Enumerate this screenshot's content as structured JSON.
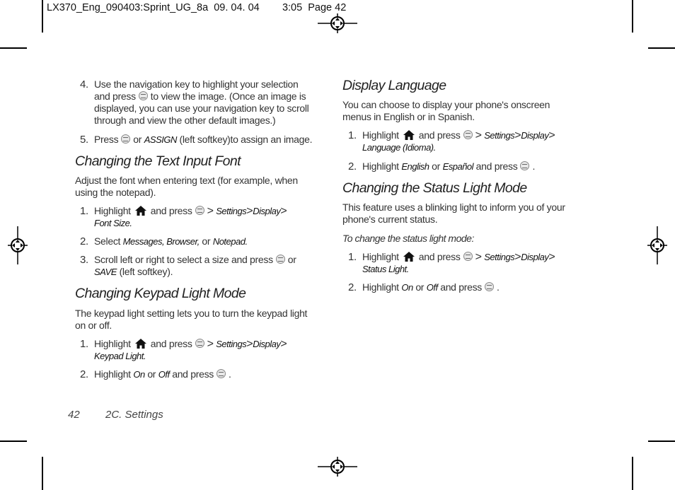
{
  "slug": {
    "file": "LX370_Eng_090403:Sprint_UG_8a",
    "date": "09. 04. 04",
    "time_page": "3:05  Page 42"
  },
  "left_column": {
    "intro_steps": [
      {
        "num": "4.",
        "line1": "Use the navigation key to highlight your selection",
        "line2a": "and press",
        "line2b": "to view the image. (Once an image is",
        "line3": "displayed, you can use your navigation key to scroll",
        "line4": "through and view the other default images.)"
      },
      {
        "num": "5.",
        "pre": "Press",
        "mid": "or",
        "em": "ASSIGN",
        "post": "(left softkey)to assign an image."
      }
    ],
    "text_input_font": {
      "heading": "Changing the Text Input Font",
      "para_line1": "Adjust the font when entering text (for example, when",
      "para_line2": "using the notepad).",
      "steps": [
        {
          "num": "1.",
          "pre": "Highlight",
          "mid": "and press",
          "path1": "Settings",
          "path2": "Display",
          "path3": "Font Size."
        },
        {
          "num": "2.",
          "pre": "Select",
          "em1": "Messages, Browser,",
          "mid": "or",
          "em2": "Notepad."
        },
        {
          "num": "3.",
          "line1": "Scroll left or right to select a size and press",
          "or": "or",
          "em": "SAVE",
          "post": "(left softkey)."
        }
      ]
    },
    "keypad_light": {
      "heading": "Changing Keypad Light Mode",
      "para_line1": "The keypad light setting lets you to turn the keypad light",
      "para_line2": "on or off.",
      "steps": [
        {
          "num": "1.",
          "pre": "Highlight",
          "mid": "and press",
          "path1": "Settings",
          "path2": "Display",
          "path3": "Keypad Light."
        },
        {
          "num": "2.",
          "pre": "Highlight",
          "em1": "On",
          "mid": "or",
          "em2": "Off",
          "post": "and press",
          "end": "."
        }
      ]
    }
  },
  "right_column": {
    "display_language": {
      "heading": "Display Language",
      "para_line1": "You can choose to display your phone's onscreen",
      "para_line2": "menus in English or in Spanish.",
      "steps": [
        {
          "num": "1.",
          "pre": "Highlight",
          "mid": "and press",
          "path1": "Settings",
          "path2": "Display",
          "path3": "Language (Idioma)."
        },
        {
          "num": "2.",
          "pre": "Highlight",
          "em1": "English",
          "mid": "or",
          "em2": "Español",
          "post": "and press",
          "end": "."
        }
      ]
    },
    "status_light": {
      "heading": "Changing the Status Light Mode",
      "para_line1": "This feature uses a blinking light to inform you of your",
      "para_line2": "phone's current status.",
      "subheading": "To change the status light mode:",
      "steps": [
        {
          "num": "1.",
          "pre": "Highlight",
          "mid": "and press",
          "path1": "Settings",
          "path2": "Display",
          "path3": "Status Light."
        },
        {
          "num": "2.",
          "pre": "Highlight",
          "em1": "On",
          "mid": "or",
          "em2": "Off",
          "post": "and press",
          "end": "."
        }
      ]
    }
  },
  "footer": {
    "page_number": "42",
    "section": "2C. Settings"
  },
  "glyphs": {
    "gt": ">"
  },
  "icons": {
    "home": "home-icon",
    "ok": "menu-ok-key-icon",
    "registration": "registration-mark-icon"
  }
}
